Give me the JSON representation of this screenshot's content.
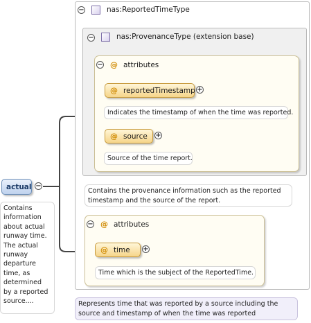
{
  "type": {
    "name": "nas:ReportedTimeType",
    "documentation": "Represents time that was reported by a source including the source and timestamp of when the time was reported"
  },
  "extension": {
    "name": "nas:ProvenanceType (extension base)",
    "documentation": "Contains the provenance information such as the reported timestamp and the source of the report."
  },
  "provenance_attributes": {
    "label": "attributes",
    "items": [
      {
        "name": "reportedTimestamp",
        "documentation": "Indicates the timestamp of when the time was reported."
      },
      {
        "name": "source",
        "documentation": "Source of the time report."
      }
    ]
  },
  "own_attributes": {
    "label": "attributes",
    "items": [
      {
        "name": "time",
        "documentation": "Time which is the subject of the ReportedTime."
      }
    ]
  },
  "element": {
    "name": "actual",
    "documentation": "Contains information about actual runway time. The actual runway departure time, as determined by a reported source...."
  },
  "icons": {
    "collapse": "⊖",
    "expand": "⊕",
    "attribute": "@"
  }
}
